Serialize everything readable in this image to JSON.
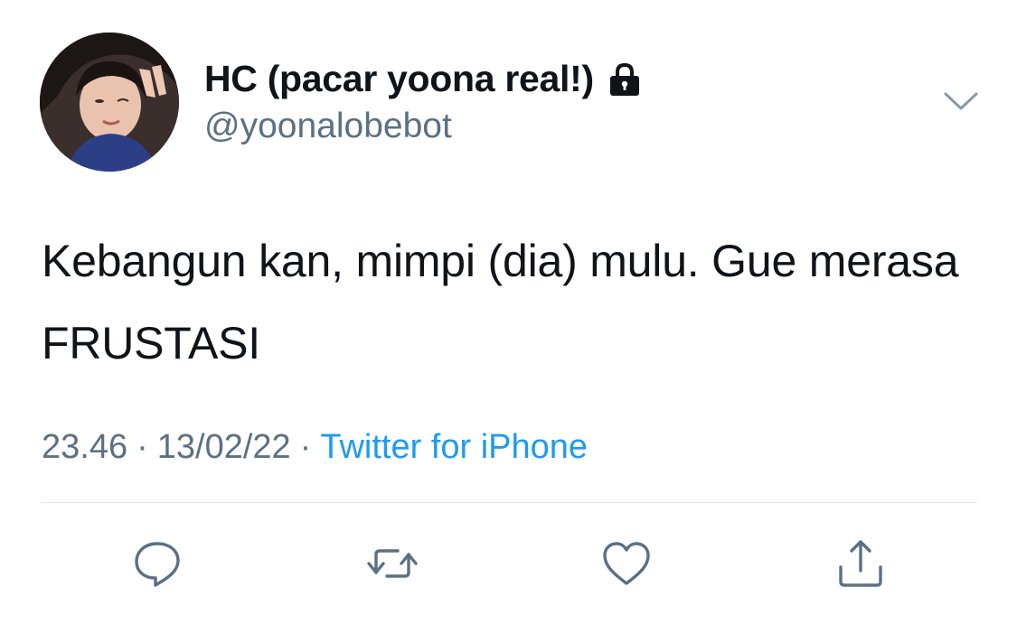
{
  "author": {
    "display_name": "HC (pacar yoona real!)",
    "handle": "@yoonalobebot",
    "protected": true,
    "avatar": "profile-photo"
  },
  "tweet": {
    "text": "Kebangun kan, mimpi (dia) mulu. Gue merasa FRUSTASI",
    "time": "23.46",
    "date": "13/02/22",
    "separator": "·",
    "source": "Twitter for iPhone"
  },
  "actions": [
    {
      "name": "reply",
      "icon": "comment-icon"
    },
    {
      "name": "retweet",
      "icon": "retweet-icon"
    },
    {
      "name": "like",
      "icon": "heart-icon"
    },
    {
      "name": "share",
      "icon": "share-icon"
    }
  ],
  "colors": {
    "text": "#0f1419",
    "secondary": "#5b7083",
    "link": "#1d9bf0",
    "divider": "#e1e8ed"
  }
}
